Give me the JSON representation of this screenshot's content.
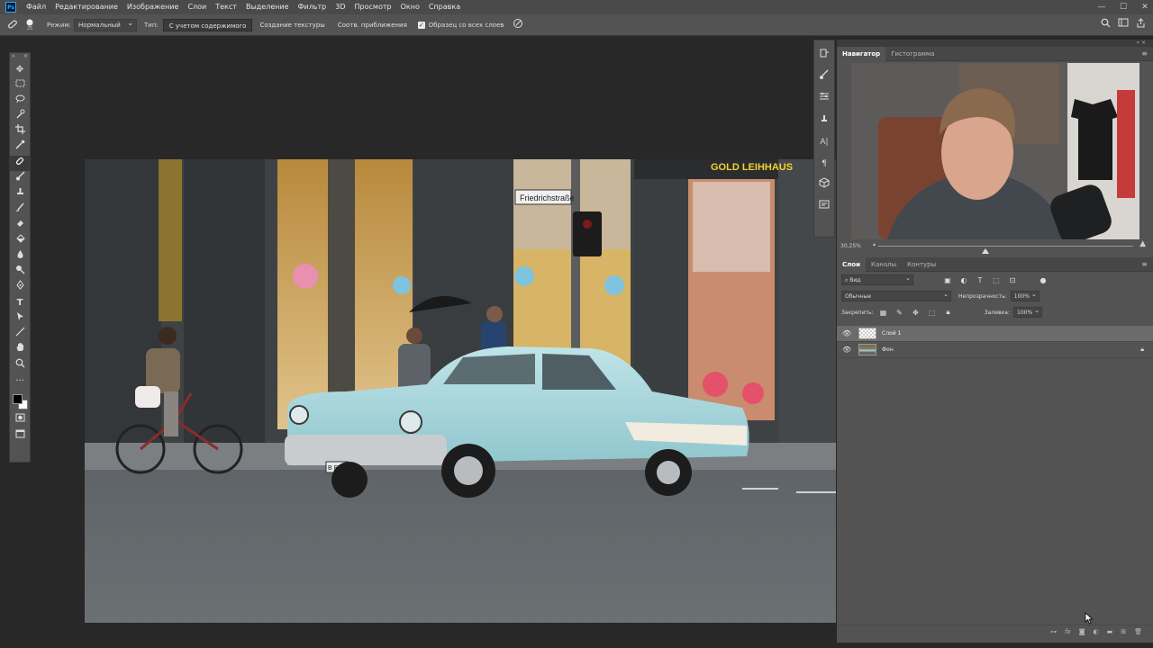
{
  "menu": {
    "logo": "Ps",
    "items": [
      "Файл",
      "Редактирование",
      "Изображение",
      "Слои",
      "Текст",
      "Выделение",
      "Фильтр",
      "3D",
      "Просмотр",
      "Окно",
      "Справка"
    ]
  },
  "window_controls": [
    "—",
    "☐",
    "✕"
  ],
  "options_bar": {
    "brush_size": "25",
    "mode_label": "Режим:",
    "mode_value": "Нормальный",
    "type_label": "Тип:",
    "type_options": [
      "С учетом содержимого",
      "Создание текстуры",
      "Соотв. приближения"
    ],
    "type_selected_index": 0,
    "sample_all_layers": "Образец со всех слоев",
    "sample_all_layers_checked": true
  },
  "navigator": {
    "tabs": [
      "Навигатор",
      "Гистограмма"
    ],
    "active_tab": 0,
    "zoom_label": "30,25%",
    "zoom_fraction": 0.42
  },
  "layers_panel": {
    "tabs": [
      "Слои",
      "Каналы",
      "Контуры"
    ],
    "active_tab": 0,
    "filter_kind": "Вид",
    "blend_mode": "Обычные",
    "opacity_label": "Непрозрачность:",
    "opacity_value": "100%",
    "lock_label": "Закрепить:",
    "fill_label": "Заливка:",
    "fill_value": "100%",
    "layers": [
      {
        "name": "Слой 1",
        "selected": true,
        "visible": true,
        "locked": false
      },
      {
        "name": "Фон",
        "selected": false,
        "visible": true,
        "locked": true
      }
    ]
  },
  "image": {
    "street_sign": "Friedrichstraße",
    "store_sign": "GOLD LEIHHAUS",
    "plate": "B EB 57"
  },
  "colors": {
    "accent": "#31a8ff",
    "car": "#a9d7dc"
  }
}
